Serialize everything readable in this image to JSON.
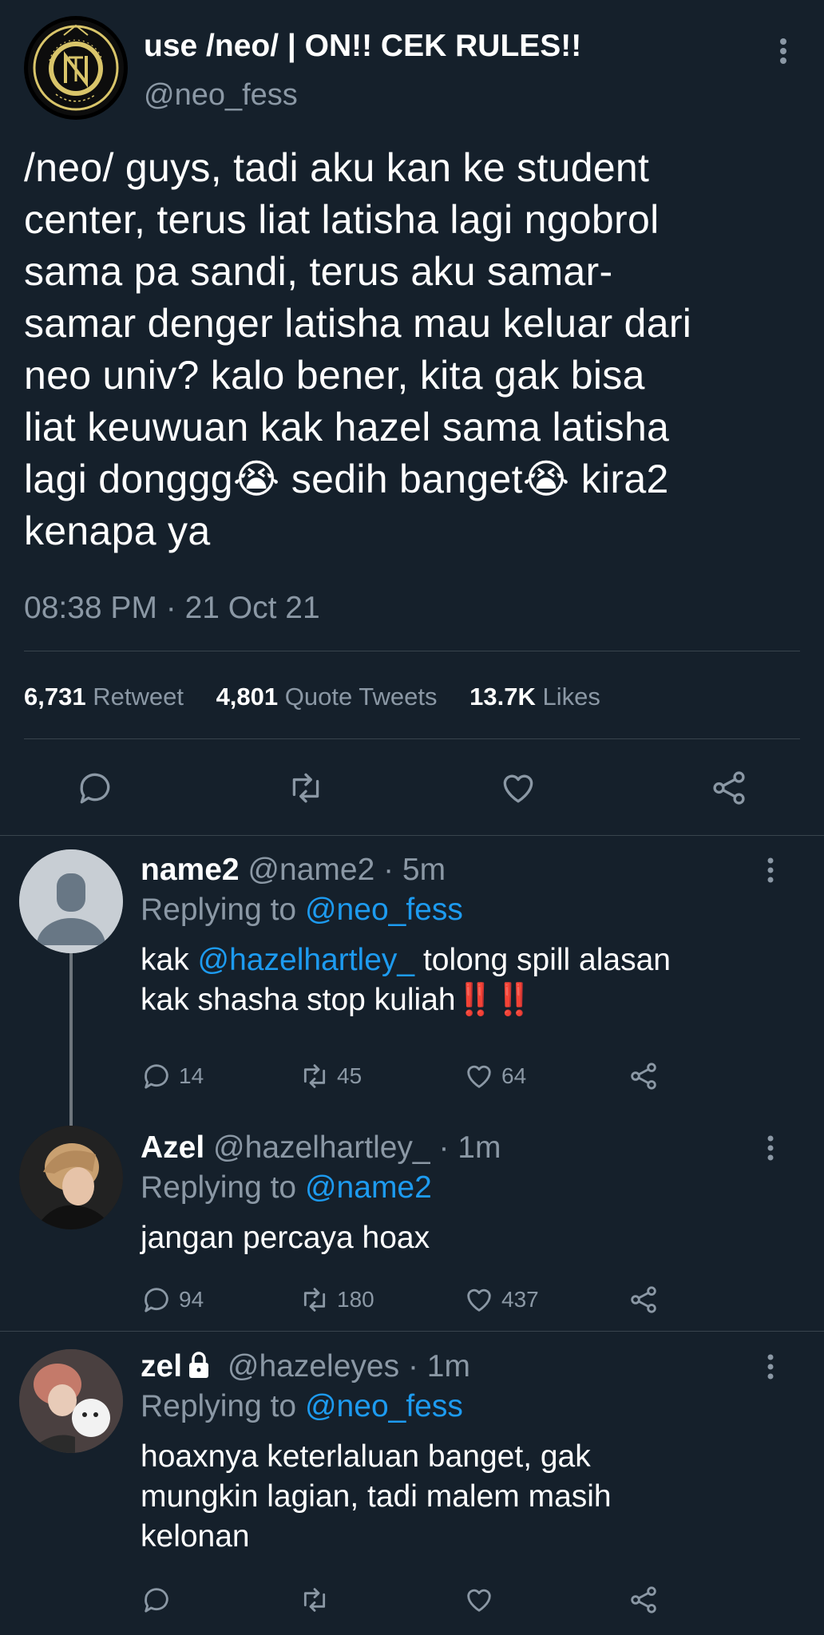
{
  "main_tweet": {
    "display_name": "use /neo/ | ON!! CEK RULES!!",
    "handle": "@neo_fess",
    "avatar_text_top": "NCTzen",
    "avatar_text_ring": "NEO CULTURE TECHNOLOGY",
    "body_lines": [
      "/neo/ guys, tadi aku kan ke student",
      "center, terus liat latisha lagi ngobrol",
      "sama pa sandi, terus aku samar-",
      "samar denger latisha mau keluar dari",
      "neo univ? kalo bener, kita gak bisa",
      "liat keuwuan kak hazel sama latisha",
      "lagi donggg",
      "sedih banget",
      "kira2",
      "kenapa ya"
    ],
    "emoji": "😭",
    "timestamp": "08:38 PM · 21 Oct 21",
    "stats": {
      "retweets": "6,731",
      "retweets_label": "Retweet",
      "quotes": "4,801",
      "quotes_label": "Quote Tweets",
      "likes": "13.7K",
      "likes_label": "Likes"
    },
    "actions": [
      "reply-icon",
      "retweet-icon",
      "like-icon",
      "share-icon"
    ]
  },
  "replies": [
    {
      "name": "name2",
      "handle": "@name2",
      "time": "· 5m",
      "replying_label": "Replying to",
      "replying_to": "@neo_fess",
      "text_line1_pre": "kak ",
      "text_mention": "@hazelhartley_",
      "text_line1_post": " tolong spill alasan",
      "text_line2": "kak shasha stop kuliah",
      "text_emoji": "‼️‼️",
      "replies": "14",
      "retweets": "45",
      "likes": "64"
    },
    {
      "name": "Azel",
      "handle": "@hazelhartley_",
      "time": "· 1m",
      "replying_label": "Replying to",
      "replying_to": "@name2",
      "text_line1": "jangan percaya hoax",
      "replies": "94",
      "retweets": "180",
      "likes": "437"
    },
    {
      "name": "zel",
      "handle": "@hazeleyes",
      "time": "· 1m",
      "replying_label": "Replying to",
      "replying_to": "@neo_fess",
      "text_lines": [
        "hoaxnya keterlaluan banget, gak",
        "mungkin lagian, tadi malem masih",
        "kelonan"
      ],
      "replies": "",
      "retweets": "",
      "likes": ""
    }
  ],
  "colors": {
    "background": "#15202b",
    "text": "#ffffff",
    "muted": "#8b98a5",
    "link": "#1d9bf0",
    "separator": "#38444d",
    "emblem_gold": "#d9c56a"
  }
}
